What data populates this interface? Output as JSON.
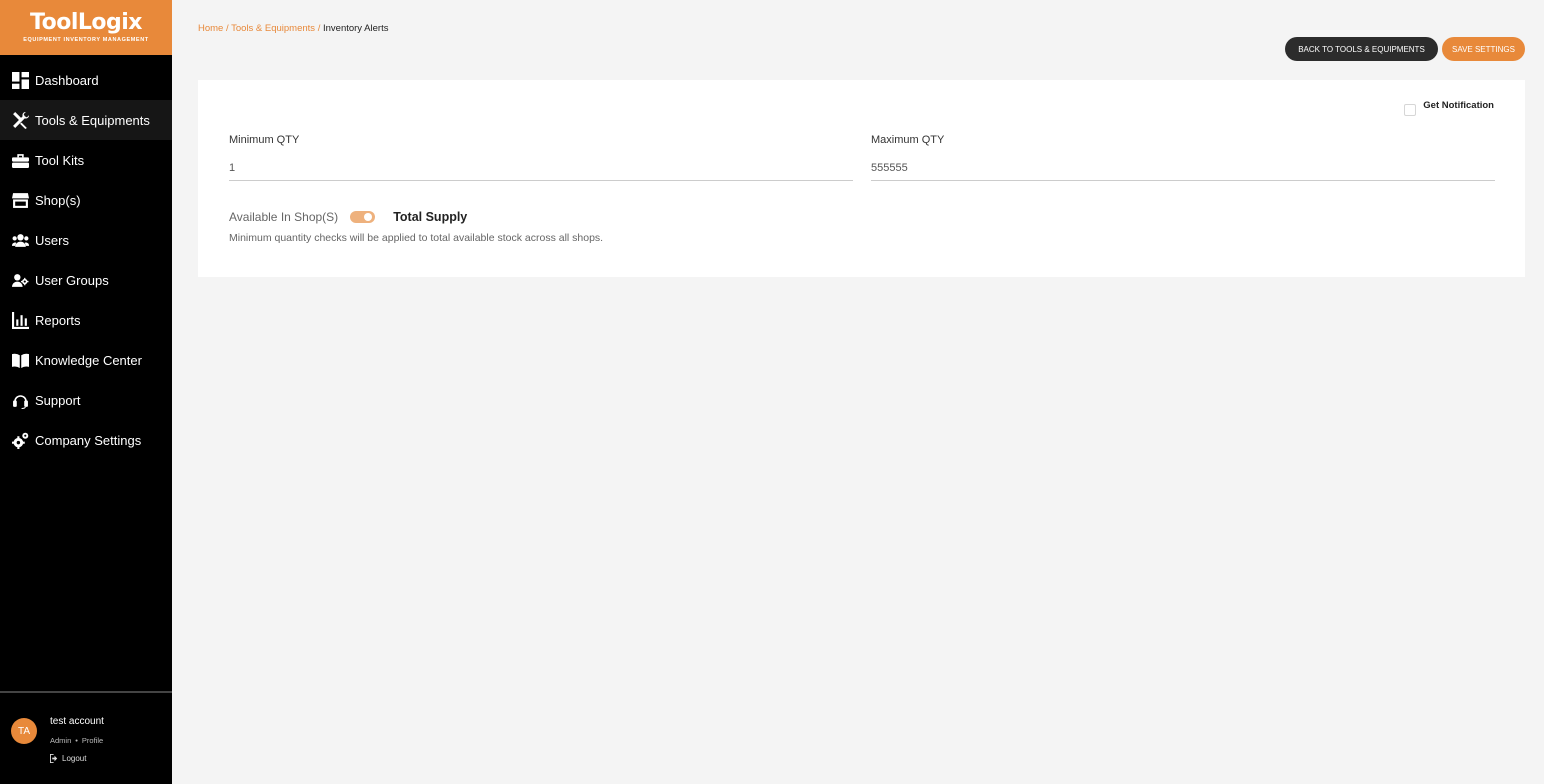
{
  "brand": {
    "name": "ToolLogix",
    "tagline": "EQUIPMENT INVENTORY MANAGEMENT",
    "accent_color": "#e8893a"
  },
  "sidebar": {
    "items": [
      {
        "label": "Dashboard",
        "icon": "dashboard-icon"
      },
      {
        "label": "Tools & Equipments",
        "icon": "tools-icon",
        "active": true
      },
      {
        "label": "Tool Kits",
        "icon": "toolbox-icon"
      },
      {
        "label": "Shop(s)",
        "icon": "store-icon"
      },
      {
        "label": "Users",
        "icon": "users-icon"
      },
      {
        "label": "User Groups",
        "icon": "user-groups-icon"
      },
      {
        "label": "Reports",
        "icon": "chart-icon"
      },
      {
        "label": "Knowledge Center",
        "icon": "book-icon"
      },
      {
        "label": "Support",
        "icon": "headset-icon"
      },
      {
        "label": "Company Settings",
        "icon": "cogs-icon"
      }
    ],
    "user": {
      "initials": "TA",
      "name": "test account",
      "role": "Admin",
      "separator": "•",
      "profile_link": "Profile",
      "logout": "Logout"
    }
  },
  "breadcrumb": {
    "home": "Home",
    "sep": "/",
    "parent": "Tools & Equipments",
    "current": "Inventory Alerts"
  },
  "actions": {
    "back": "BACK TO TOOLS & EQUIPMENTS",
    "save": "SAVE SETTINGS"
  },
  "form": {
    "notification_label": "Get Notification",
    "notification_checked": false,
    "min_label": "Minimum QTY",
    "min_value": "1",
    "max_label": "Maximum QTY",
    "max_value": "555555",
    "toggle_label": "Available In Shop(S)",
    "toggle_state": "Total Supply",
    "toggle_on": true,
    "help_text": "Minimum quantity checks will be applied to total available stock across all shops."
  }
}
